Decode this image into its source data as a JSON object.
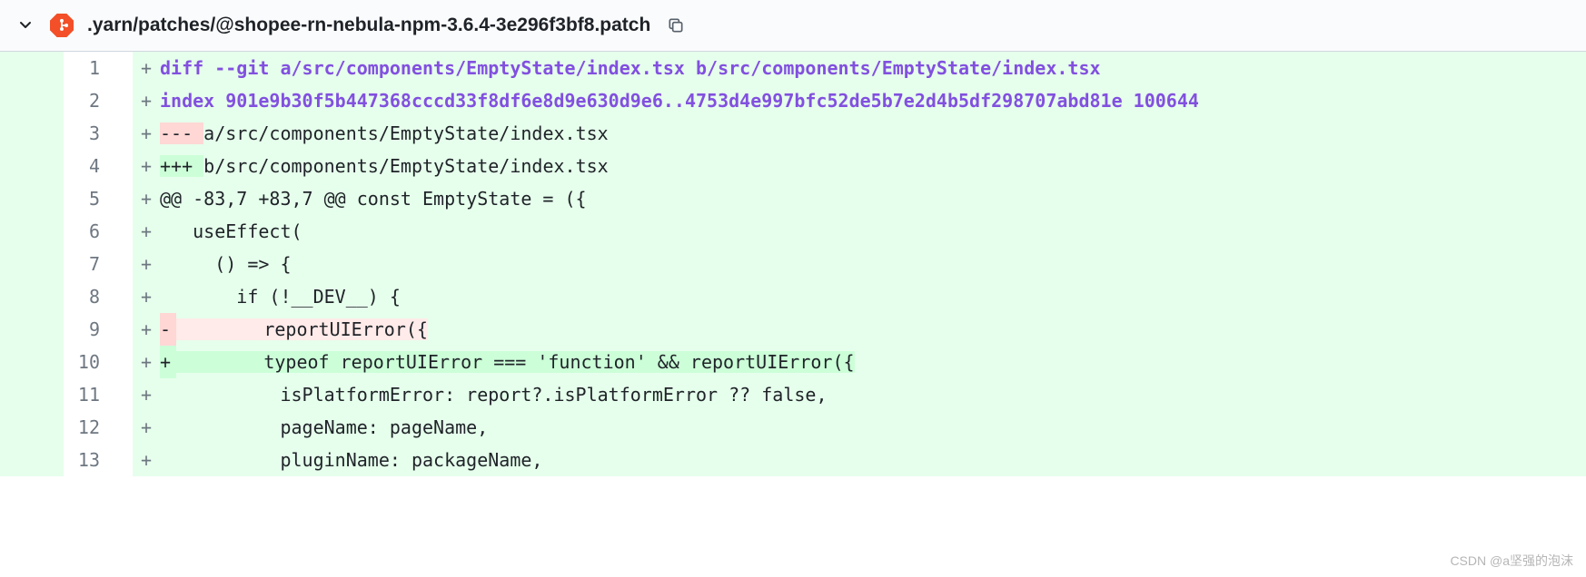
{
  "header": {
    "file_path": ".yarn/patches/@shopee-rn-nebula-npm-3.6.4-3e296f3bf8.patch"
  },
  "diff": {
    "lines": [
      {
        "num": "1",
        "marker": "+",
        "sign": "",
        "cls": "fg-header",
        "row_bg": "bg-add",
        "sign_bg": "bg-add",
        "code_bg": "bg-add",
        "text": "diff --git a/src/components/EmptyState/index.tsx b/src/components/EmptyState/index.tsx"
      },
      {
        "num": "2",
        "marker": "+",
        "sign": "",
        "cls": "fg-index",
        "row_bg": "bg-add",
        "sign_bg": "bg-add",
        "code_bg": "bg-add",
        "text": "index 901e9b30f5b447368cccd33f8df6e8d9e630d9e6..4753d4e997bfc52de5b7e2d4b5df298707abd81e 100644"
      },
      {
        "num": "3",
        "marker": "+",
        "sign": "",
        "cls": "fg-normal",
        "row_bg": "bg-add",
        "sign_bg": "bg-del-strong",
        "code_bg": "bg-add",
        "sign_text": "--- ",
        "text": "a/src/components/EmptyState/index.tsx"
      },
      {
        "num": "4",
        "marker": "+",
        "sign": "",
        "cls": "fg-normal",
        "row_bg": "bg-add",
        "sign_bg": "bg-add-strong",
        "code_bg": "bg-add",
        "sign_text": "+++ ",
        "text": "b/src/components/EmptyState/index.tsx"
      },
      {
        "num": "5",
        "marker": "+",
        "sign": "",
        "cls": "fg-hunk",
        "row_bg": "bg-add",
        "sign_bg": "bg-add",
        "code_bg": "bg-add",
        "text": "@@ -83,7 +83,7 @@ const EmptyState = ({"
      },
      {
        "num": "6",
        "marker": "+",
        "sign": "",
        "cls": "fg-normal",
        "row_bg": "bg-add",
        "sign_bg": "bg-add",
        "code_bg": "bg-add",
        "text": "   useEffect("
      },
      {
        "num": "7",
        "marker": "+",
        "sign": "",
        "cls": "fg-normal",
        "row_bg": "bg-add",
        "sign_bg": "bg-add",
        "code_bg": "bg-add",
        "text": "     () => {"
      },
      {
        "num": "8",
        "marker": "+",
        "sign": "",
        "cls": "fg-normal",
        "row_bg": "bg-add",
        "sign_bg": "bg-add",
        "code_bg": "bg-add",
        "text": "       if (!__DEV__) {"
      },
      {
        "num": "9",
        "marker": "+",
        "sign": "-",
        "cls": "fg-normal",
        "row_bg": "bg-add",
        "sign_bg": "bg-del-strong",
        "code_bg": "bg-del-light",
        "text": "        reportUIError({"
      },
      {
        "num": "10",
        "marker": "+",
        "sign": "+",
        "cls": "fg-normal",
        "row_bg": "bg-add",
        "sign_bg": "bg-add-strong",
        "code_bg": "bg-add-strong",
        "text": "        typeof reportUIError === 'function' && reportUIError({"
      },
      {
        "num": "11",
        "marker": "+",
        "sign": "",
        "cls": "fg-normal",
        "row_bg": "bg-add",
        "sign_bg": "bg-add",
        "code_bg": "bg-add",
        "text": "           isPlatformError: report?.isPlatformError ?? false,"
      },
      {
        "num": "12",
        "marker": "+",
        "sign": "",
        "cls": "fg-normal",
        "row_bg": "bg-add",
        "sign_bg": "bg-add",
        "code_bg": "bg-add",
        "text": "           pageName: pageName,"
      },
      {
        "num": "13",
        "marker": "+",
        "sign": "",
        "cls": "fg-normal",
        "row_bg": "bg-add",
        "sign_bg": "bg-add",
        "code_bg": "bg-add",
        "text": "           pluginName: packageName,"
      }
    ]
  },
  "watermark": "CSDN @a坚强的泡沫"
}
